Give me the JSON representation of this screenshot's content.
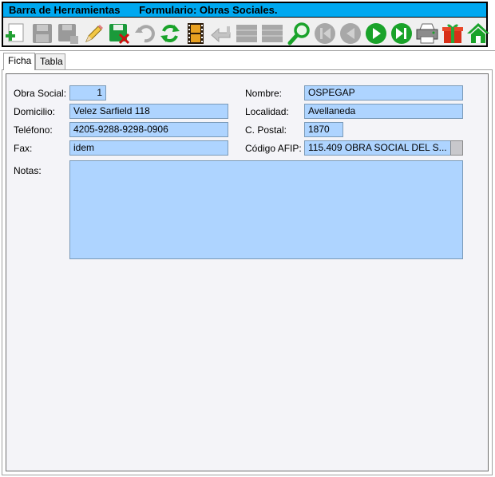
{
  "toolbar": {
    "title": "Barra de Herramientas",
    "form_title": "Formulario: Obras Sociales.",
    "buttons": [
      {
        "icon": "add-record-icon",
        "enabled": true
      },
      {
        "icon": "save-icon",
        "enabled": false
      },
      {
        "icon": "save-copy-icon",
        "enabled": false
      },
      {
        "icon": "edit-pencil-icon",
        "enabled": true
      },
      {
        "icon": "delete-record-icon",
        "enabled": true
      },
      {
        "icon": "undo-icon",
        "enabled": false
      },
      {
        "icon": "refresh-icon",
        "enabled": true
      },
      {
        "icon": "film-strip-icon",
        "enabled": true
      },
      {
        "icon": "return-arrow-icon",
        "enabled": false
      },
      {
        "icon": "grid-icon",
        "enabled": false
      },
      {
        "icon": "grid-alt-icon",
        "enabled": false
      },
      {
        "icon": "search-icon",
        "enabled": true
      },
      {
        "icon": "first-record-icon",
        "enabled": false
      },
      {
        "icon": "previous-record-icon",
        "enabled": false
      },
      {
        "icon": "next-record-icon",
        "enabled": true
      },
      {
        "icon": "last-record-icon",
        "enabled": true
      },
      {
        "icon": "printer-icon",
        "enabled": true
      },
      {
        "icon": "gift-icon",
        "enabled": true
      },
      {
        "icon": "home-icon",
        "enabled": true
      }
    ]
  },
  "tabs": [
    {
      "label": "Ficha",
      "active": true
    },
    {
      "label": "Tabla",
      "active": false
    }
  ],
  "form": {
    "obra_social": {
      "label": "Obra Social:",
      "value": "1"
    },
    "nombre": {
      "label": "Nombre:",
      "value": "OSPEGAP"
    },
    "domicilio": {
      "label": "Domicilio:",
      "value": "Velez Sarfield 118"
    },
    "localidad": {
      "label": "Localidad:",
      "value": "Avellaneda"
    },
    "telefono": {
      "label": "Teléfono:",
      "value": "4205-9288-9298-0906"
    },
    "codigo_postal": {
      "label": "C. Postal:",
      "value": "1870"
    },
    "fax": {
      "label": "Fax:",
      "value": "idem"
    },
    "codigo_afip": {
      "label": "Código AFIP:",
      "value": "115.409 OBRA SOCIAL DEL S..."
    },
    "notas": {
      "label": "Notas:",
      "value": ""
    }
  },
  "colors": {
    "titlebar": "#00a8f0",
    "field_bg": "#aed4ff",
    "enabled_green": "#1aa32a",
    "disabled_gray": "#a8a8a8"
  }
}
